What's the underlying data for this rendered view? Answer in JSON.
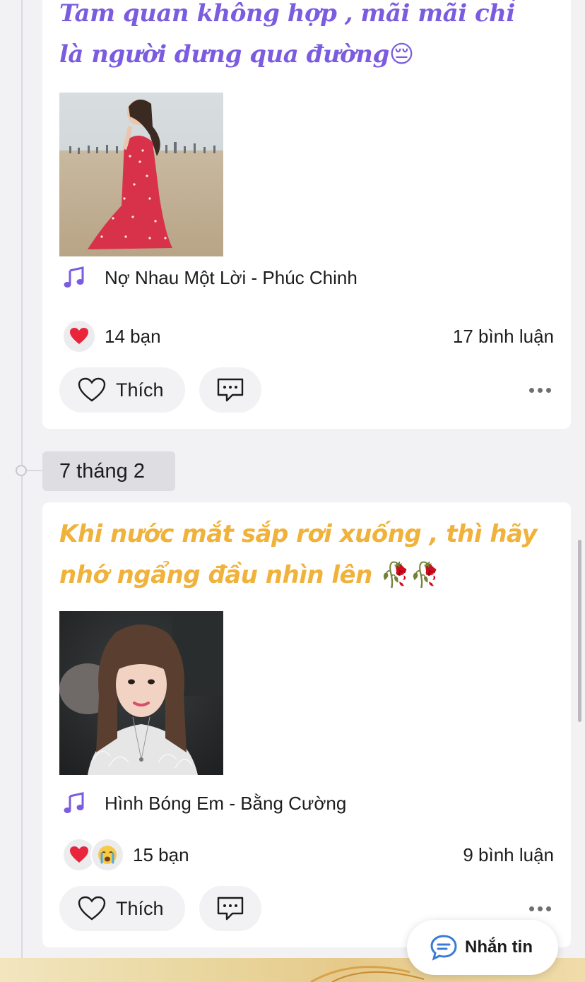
{
  "posts": [
    {
      "caption": "Tam quan không hợp , mãi mãi chỉ là người dưng qua đường",
      "caption_emoji": "😔",
      "caption_color": "#7b5ce0",
      "photo_alt": "Cô gái váy đỏ ngồi trên bãi biển",
      "music": "Nợ Nhau Một Lời - Phúc Chinh",
      "reactions": [
        "heart"
      ],
      "reaction_count": "14 bạn",
      "comment_count": "17 bình luận",
      "like_label": "Thích"
    },
    {
      "caption": "Khi nước mắt sắp rơi xuống , thì hãy nhớ ngẩng đầu nhìn lên",
      "caption_emoji": "🥀🥀",
      "caption_color": "#f0b23a",
      "photo_alt": "Ảnh chân dung cô gái",
      "music": "Hình Bóng Em - Bằng Cường",
      "reactions": [
        "heart",
        "crying-face"
      ],
      "reaction_count": "15 bạn",
      "comment_count": "9 bình luận",
      "like_label": "Thích"
    }
  ],
  "date_separator": "7 tháng 2",
  "chat_button": {
    "label": "Nhắn tin",
    "icon": "chat-bubble-icon"
  },
  "colors": {
    "heart": "#e8253b",
    "music_icon": "#7b5ce0",
    "chat_icon": "#3a7bd5",
    "background": "#f2f2f5"
  }
}
